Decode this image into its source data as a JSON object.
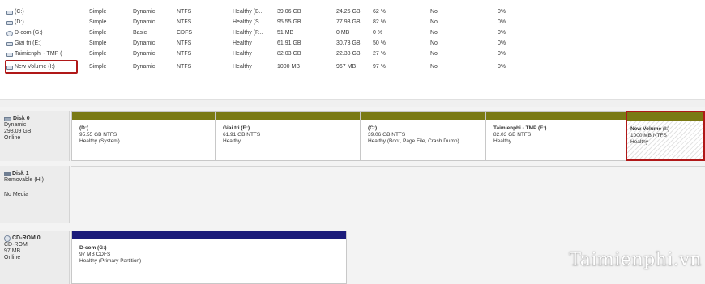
{
  "volumes": [
    {
      "name": "(C:)",
      "layout": "Simple",
      "type": "Dynamic",
      "fs": "NTFS",
      "status": "Healthy (B...",
      "capacity": "39.06 GB",
      "free": "24.26 GB",
      "pct_free": "62 %",
      "fault_tolerance": "No",
      "overhead": "0%",
      "icon": "disk-icon"
    },
    {
      "name": "(D:)",
      "layout": "Simple",
      "type": "Dynamic",
      "fs": "NTFS",
      "status": "Healthy (S...",
      "capacity": "95.55 GB",
      "free": "77.93 GB",
      "pct_free": "82 %",
      "fault_tolerance": "No",
      "overhead": "0%",
      "icon": "disk-icon"
    },
    {
      "name": "D-com (G:)",
      "layout": "Simple",
      "type": "Basic",
      "fs": "CDFS",
      "status": "Healthy (P...",
      "capacity": "51 MB",
      "free": "0 MB",
      "pct_free": "0 %",
      "fault_tolerance": "No",
      "overhead": "0%",
      "icon": "cdrom-icon"
    },
    {
      "name": "Giai tri (E:)",
      "layout": "Simple",
      "type": "Dynamic",
      "fs": "NTFS",
      "status": "Healthy",
      "capacity": "61.91 GB",
      "free": "30.73 GB",
      "pct_free": "50 %",
      "fault_tolerance": "No",
      "overhead": "0%",
      "icon": "disk-icon"
    },
    {
      "name": "Taimienphi - TMP (",
      "layout": "Simple",
      "type": "Dynamic",
      "fs": "NTFS",
      "status": "Healthy",
      "capacity": "82.03 GB",
      "free": "22.38 GB",
      "pct_free": "27 %",
      "fault_tolerance": "No",
      "overhead": "0%",
      "icon": "disk-icon"
    },
    {
      "name": "New Volume (I:)",
      "layout": "Simple",
      "type": "Dynamic",
      "fs": "NTFS",
      "status": "Healthy",
      "capacity": "1000 MB",
      "free": "967 MB",
      "pct_free": "97 %",
      "fault_tolerance": "No",
      "overhead": "0%",
      "icon": "disk-icon"
    }
  ],
  "disks": {
    "disk0": {
      "name": "Disk 0",
      "type": "Dynamic",
      "size": "298.09 GB",
      "status": "Online",
      "partitions": [
        {
          "name": "(D:)",
          "size_fs": "95.55 GB NTFS",
          "status": "Healthy (System)"
        },
        {
          "name": "Giai tri (E:)",
          "size_fs": "61.91 GB NTFS",
          "status": "Healthy"
        },
        {
          "name": "(C:)",
          "size_fs": "39.06 GB NTFS",
          "status": "Healthy (Boot, Page File, Crash Dump)"
        },
        {
          "name": "Taimienphi - TMP (F:)",
          "size_fs": "82.03 GB NTFS",
          "status": "Healthy"
        },
        {
          "name": "New Volume (I:)",
          "size_fs": "1000 MB NTFS",
          "status": "Healthy"
        }
      ]
    },
    "disk1": {
      "name": "Disk 1",
      "type": "Removable (H:)",
      "status": "No Media"
    },
    "cdrom0": {
      "name": "CD-ROM 0",
      "type": "CD-ROM",
      "size": "97 MB",
      "status": "Online",
      "partition": {
        "name": "D-com (G:)",
        "size_fs": "97 MB CDFS",
        "status": "Healthy (Primary Partition)"
      }
    }
  },
  "colors": {
    "primary_partition_bar": "#7a7a14",
    "cdrom_partition_bar": "#1b1b7a",
    "selection_border": "#b01818"
  },
  "watermark": "Taimienphi.vn"
}
